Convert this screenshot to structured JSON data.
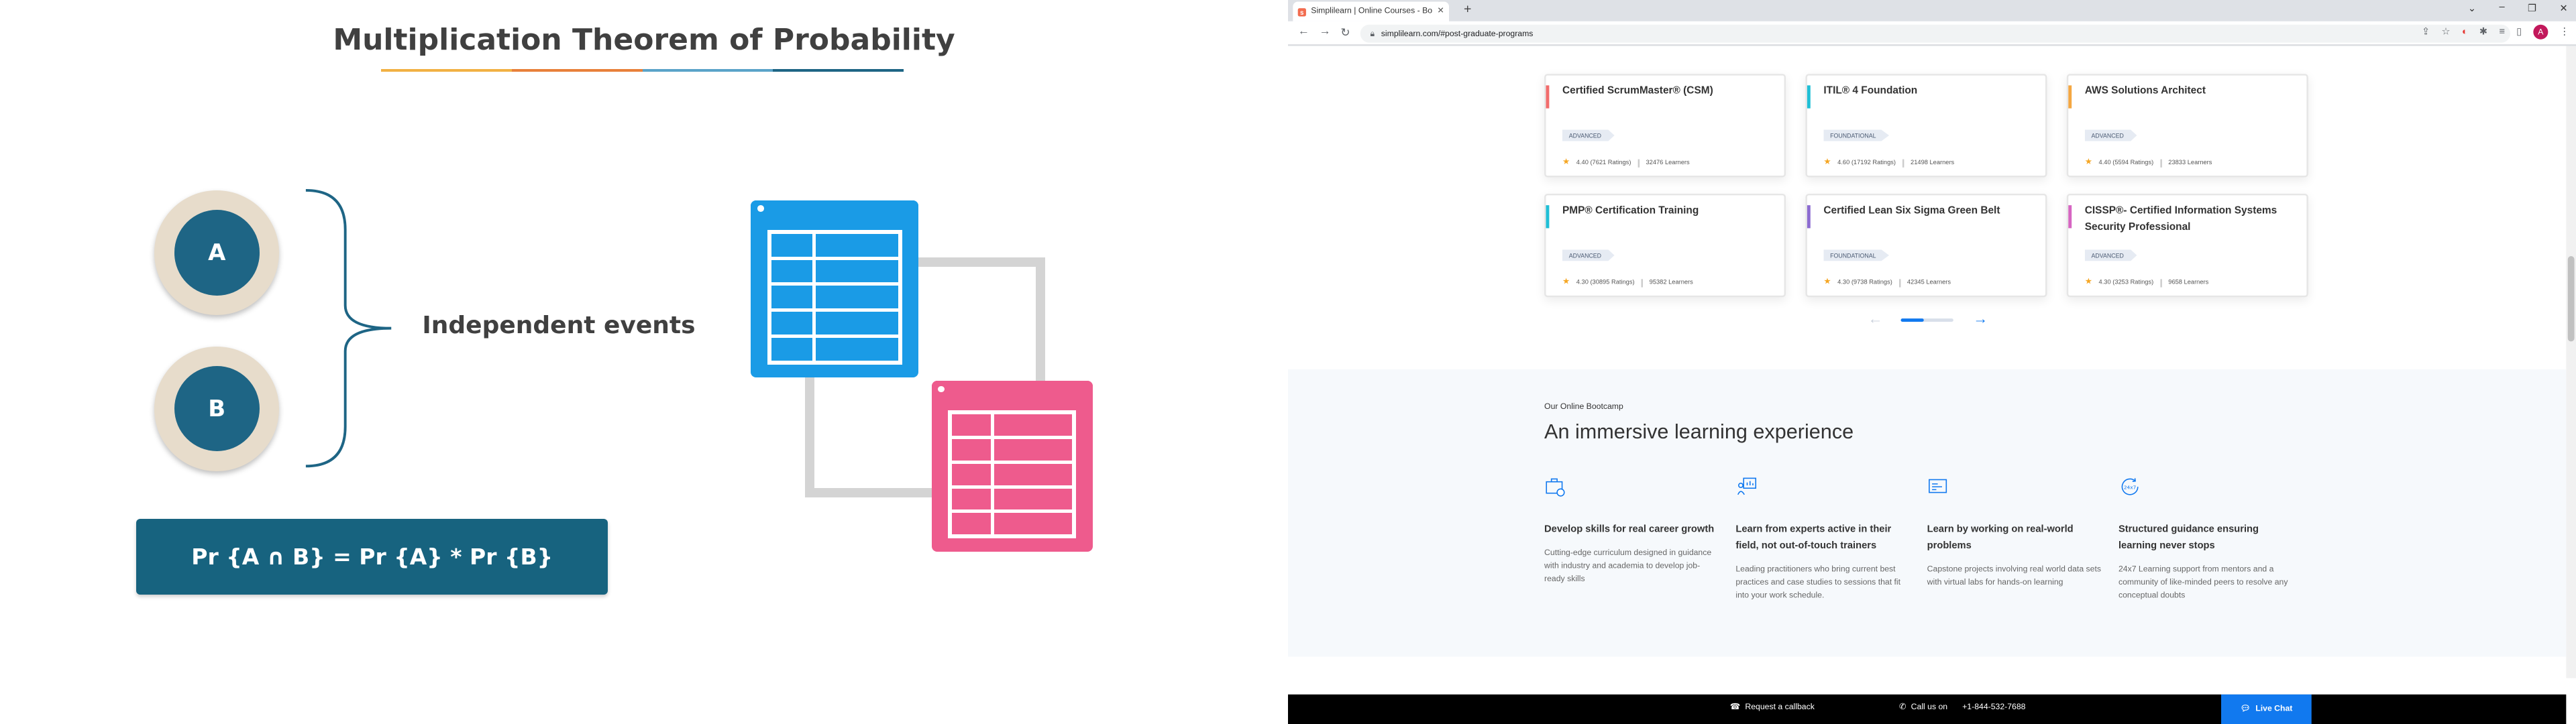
{
  "slide": {
    "title": "Multiplication Theorem of Probability",
    "title_bar_colors": [
      "#f2b144",
      "#e8803a",
      "#5aa3c9",
      "#1e6585"
    ],
    "event_a": "A",
    "event_b": "B",
    "label": "Independent events",
    "formula": "Pr {A ∩ B} = Pr {A} * Pr {B}",
    "colors": {
      "circle_fill": "#1e6585",
      "circle_ring": "#e7dccb",
      "formula_bg": "#17637f",
      "blue_window": "#1a9be6",
      "pink_window": "#ee5b8d"
    }
  },
  "browser": {
    "tab_title": "Simplilearn | Online Courses - Bootcamp...",
    "tab_favicon": "simplilearn-favicon",
    "url": "simplilearn.com/#post-graduate-programs",
    "profile_initial": "A",
    "toolbar_icons": [
      "share-icon",
      "star-icon",
      "adblock-icon",
      "extensions-icon",
      "media-icon",
      "sidepanel-icon"
    ]
  },
  "courses": [
    {
      "title": "Certified ScrumMaster® (CSM)",
      "accent": "#f26c6c",
      "level": "ADVANCED",
      "rating": "4.40 (7621 Ratings)",
      "learners": "32476 Learners"
    },
    {
      "title": "ITIL® 4 Foundation",
      "accent": "#1fbfd6",
      "level": "FOUNDATIONAL",
      "rating": "4.60 (17192 Ratings)",
      "learners": "21498 Learners"
    },
    {
      "title": "AWS Solutions Architect",
      "accent": "#f4a742",
      "level": "ADVANCED",
      "rating": "4.40 (5594 Ratings)",
      "learners": "23833 Learners"
    },
    {
      "title": "PMP® Certification Training",
      "accent": "#1fbfd6",
      "level": "ADVANCED",
      "rating": "4.30 (30895 Ratings)",
      "learners": "95382 Learners"
    },
    {
      "title": "Certified Lean Six Sigma Green Belt",
      "accent": "#8c6bd1",
      "level": "FOUNDATIONAL",
      "rating": "4.30 (9738 Ratings)",
      "learners": "42345 Learners"
    },
    {
      "title": "CISSP®- Certified Information Systems Security Professional",
      "accent": "#d665c2",
      "level": "ADVANCED",
      "rating": "4.30 (3253 Ratings)",
      "learners": "9658 Learners"
    }
  ],
  "carousel": {
    "prev": "←",
    "next": "→",
    "progress": 0.45
  },
  "bootcamp": {
    "eyebrow": "Our Online Bootcamp",
    "heading": "An immersive learning experience",
    "features": [
      {
        "icon": "briefcase-icon",
        "title": "Develop skills for real career growth",
        "desc": "Cutting-edge curriculum designed in guidance with industry and academia to develop job-ready skills"
      },
      {
        "icon": "expert-board-icon",
        "title": "Learn from experts active in their field, not out-of-touch trainers",
        "desc": "Leading practitioners who bring current best practices and case studies to sessions that fit into your work schedule."
      },
      {
        "icon": "project-doc-icon",
        "title": "Learn by working on real-world problems",
        "desc": "Capstone projects involving real world data sets with virtual labs for hands-on learning"
      },
      {
        "icon": "support-24x7-icon",
        "title": "Structured guidance ensuring learning never stops",
        "desc": "24x7 Learning support from mentors and a community of like-minded peers to resolve any conceptual doubts"
      }
    ]
  },
  "bottom_bar": {
    "callback": "Request a callback",
    "call_label": "Call us on",
    "phone": "+1-844-532-7688",
    "chat": "Live Chat"
  }
}
